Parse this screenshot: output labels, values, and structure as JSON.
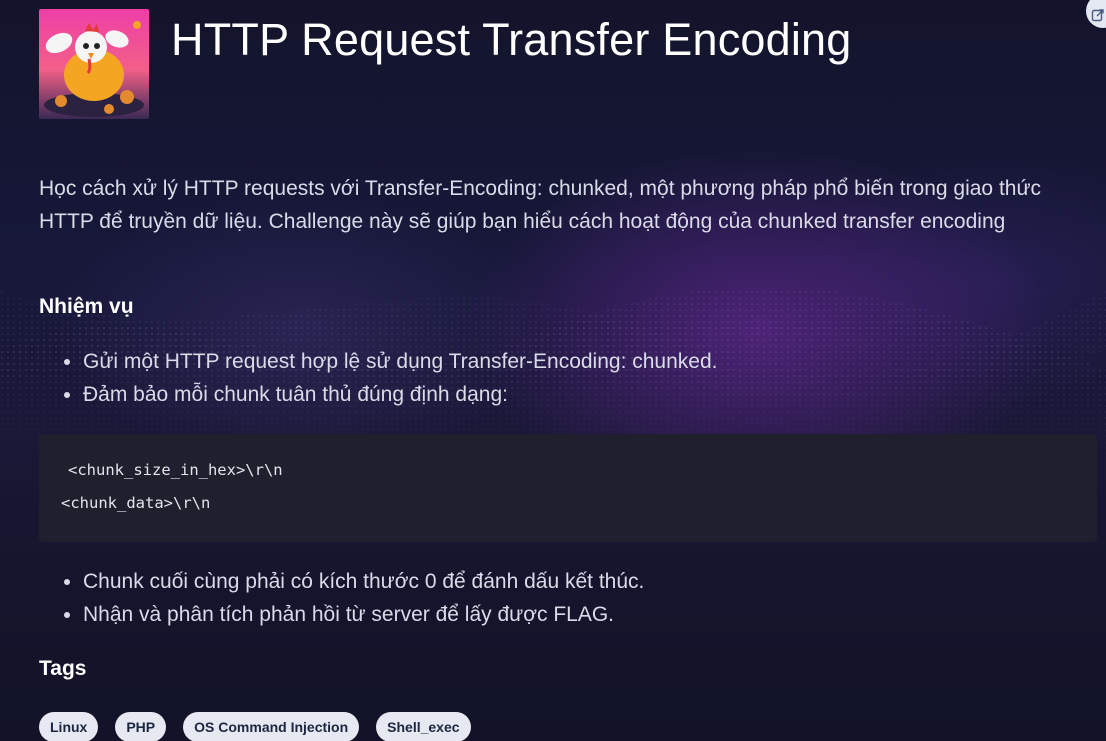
{
  "challenge": {
    "title": "HTTP Request Transfer Encoding",
    "description": "Học cách xử lý HTTP requests với Transfer-Encoding: chunked, một phương pháp phổ biến trong giao thức HTTP để truyền dữ liệu. Challenge này sẽ giúp bạn hiểu cách hoạt động của chunked transfer encoding"
  },
  "task": {
    "heading": "Nhiệm vụ",
    "items_before_code": [
      "Gửi một HTTP request hợp lệ sử dụng Transfer-Encoding: chunked.",
      "Đảm bảo mỗi chunk tuân thủ đúng định dạng:"
    ],
    "code_lines": [
      "<chunk_size_in_hex>\\r\\n",
      "<chunk_data>\\r\\n"
    ],
    "items_after_code": [
      "Chunk cuối cùng phải có kích thước 0 để đánh dấu kết thúc.",
      "Nhận và phân tích phản hồi từ server để lấy được FLAG."
    ]
  },
  "tags": {
    "heading": "Tags",
    "items": [
      "Linux",
      "PHP",
      "OS Command Injection",
      "Shell_exec"
    ]
  },
  "icons": {
    "avatar": "chicken-mascot-icon",
    "corner": "open-external-icon"
  },
  "colors": {
    "background": "#13152b",
    "accent_glow": "#782daa",
    "title": "#ffffff",
    "body_text": "#d9dbe8",
    "code_bg": "#1f1f2e",
    "tag_bg": "#e6e8f2",
    "tag_text": "#1c2640"
  }
}
